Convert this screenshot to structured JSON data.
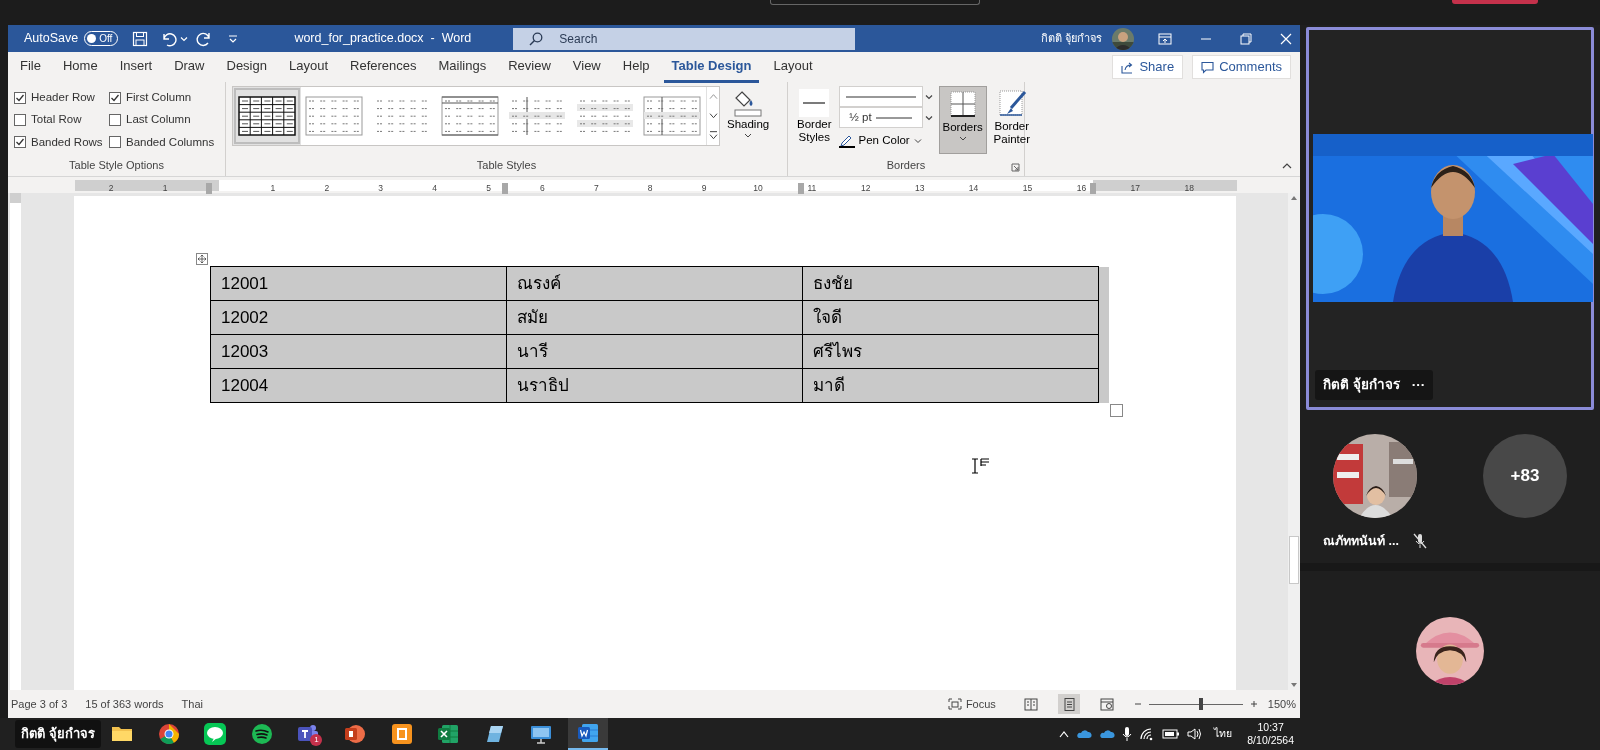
{
  "title_bar": {
    "autosave": "AutoSave",
    "autosave_toggle": {
      "label": "Off",
      "on": false
    },
    "document_title": "word_for_practice.docx  -  Word",
    "search": {
      "placeholder": "Search"
    },
    "user_name": "กิตติ จุ้ยกำจร"
  },
  "ribbon_tabs": [
    {
      "label": "File",
      "selected": false
    },
    {
      "label": "Home",
      "selected": false
    },
    {
      "label": "Insert",
      "selected": false
    },
    {
      "label": "Draw",
      "selected": false
    },
    {
      "label": "Design",
      "selected": false
    },
    {
      "label": "Layout",
      "selected": false
    },
    {
      "label": "References",
      "selected": false
    },
    {
      "label": "Mailings",
      "selected": false
    },
    {
      "label": "Review",
      "selected": false
    },
    {
      "label": "View",
      "selected": false
    },
    {
      "label": "Help",
      "selected": false
    },
    {
      "label": "Table Design",
      "selected": true
    },
    {
      "label": "Layout",
      "selected": false
    }
  ],
  "share_button": "Share",
  "comments_button": "Comments",
  "table_style_options": {
    "title": "Table Style Options",
    "options": [
      {
        "label": "Header Row",
        "checked": true
      },
      {
        "label": "First Column",
        "checked": true
      },
      {
        "label": "Total Row",
        "checked": false
      },
      {
        "label": "Last Column",
        "checked": false
      },
      {
        "label": "Banded Rows",
        "checked": true
      },
      {
        "label": "Banded Columns",
        "checked": false
      }
    ]
  },
  "table_styles": {
    "title": "Table Styles",
    "gallery": [
      {
        "selected": true
      },
      {
        "selected": false
      },
      {
        "selected": false
      },
      {
        "selected": false
      },
      {
        "selected": false
      },
      {
        "selected": false
      },
      {
        "selected": false
      }
    ],
    "shading_button": "Shading"
  },
  "borders_group": {
    "title": "Borders",
    "border_styles_button": "Border Styles",
    "pen_weight": "½ pt",
    "pen_color_button": "Pen Color",
    "borders_button": {
      "label": "Borders",
      "selected": true
    },
    "border_painter_button": "Border Painter"
  },
  "ruler": {
    "labels": [
      "2",
      "1",
      "1",
      "2",
      "3",
      "4",
      "5",
      "6",
      "7",
      "8",
      "9",
      "10",
      "11",
      "12",
      "13",
      "14",
      "15",
      "16",
      "17",
      "18"
    ]
  },
  "document": {
    "table": {
      "rows": [
        [
          "12001",
          "ณรงค์",
          "ธงชัย"
        ],
        [
          "12002",
          "สมัย",
          "ใจดี"
        ],
        [
          "12003",
          "นารี",
          "ศรีไพร"
        ],
        [
          "12004",
          "นราธิป",
          "มาดี"
        ]
      ]
    }
  },
  "status_bar": {
    "page": "Page 3 of 3",
    "words": "15 of 363 words",
    "language": "Thai",
    "focus": "Focus",
    "view_modes": [
      {
        "selected": false
      },
      {
        "selected": true
      },
      {
        "selected": false
      }
    ],
    "zoom": {
      "level": 0.55,
      "reading": "150%"
    }
  },
  "taskbar": {
    "tooltip": "กิตติ จุ้ยกำจร",
    "apps": [
      {
        "kind": "explorer",
        "selected": false
      },
      {
        "kind": "chrome",
        "selected": false
      },
      {
        "kind": "line",
        "selected": false
      },
      {
        "kind": "spotify",
        "selected": false
      },
      {
        "kind": "teams",
        "selected": false,
        "badge": "1"
      },
      {
        "kind": "powerpoint",
        "selected": false
      },
      {
        "kind": "orange",
        "selected": false
      },
      {
        "kind": "excel",
        "selected": false
      },
      {
        "kind": "pen",
        "selected": false
      },
      {
        "kind": "screen",
        "selected": false
      },
      {
        "kind": "word",
        "selected": true
      }
    ],
    "language": "ไทย",
    "time": "10:37",
    "date": "8/10/2564"
  },
  "meeting": {
    "main_tile": {
      "name": "กิตติ จุ้ยกำจร",
      "more": "···",
      "speaking": true
    },
    "participants": [
      {
        "kind": "avatar",
        "name": "ณภัททนันท์ ...",
        "muted": true
      },
      {
        "kind": "overflow",
        "label": "+83"
      },
      {
        "kind": "avatar"
      }
    ]
  }
}
